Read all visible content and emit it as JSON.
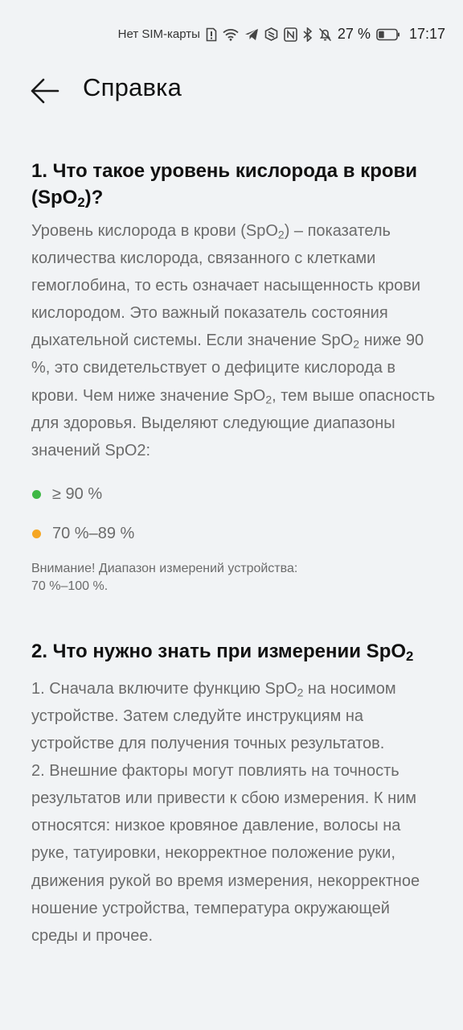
{
  "status_bar": {
    "carrier": "Нет SIM-карты",
    "battery_pct": "27 %",
    "time": "17:17"
  },
  "header": {
    "title": "Справка"
  },
  "section1": {
    "title_pre": "1. Что такое уровень кислорода в крови (SpO",
    "title_sub": "2",
    "title_post": ")?",
    "p1": "Уровень кислорода в крови (SpO",
    "p1_sub": "2",
    "p2": ") – показатель количества кислорода, связанного с клетками гемоглобина, то есть означает насыщенность крови кислородом. Это важный показатель состояния дыхательной системы. Если значение SpO",
    "p2_sub": "2",
    "p3": " ниже 90 %, это свидетельствует о дефиците кислорода в крови. Чем ниже значение SpO",
    "p3_sub": "2",
    "p4": ", тем выше опасность для здоровья. Выделяют следующие диапазоны значений SpO2:",
    "ranges": [
      {
        "label": "≥ 90 %",
        "color": "#3fb845"
      },
      {
        "label": "70 %–89 %",
        "color": "#f5a623"
      }
    ],
    "note_line1": "Внимание! Диапазон измерений устройства:",
    "note_line2": "70 %–100 %."
  },
  "section2": {
    "title_pre": "2. Что нужно знать при измерении SpO",
    "title_sub": "2",
    "item1_pre": "1. Сначала включите функцию SpO",
    "item1_sub": "2",
    "item1_post": " на носимом устройстве. Затем следуйте инструкциям на устройстве для получения точных результатов.",
    "item2": "2. Внешние факторы могут повлиять на точность результатов или привести к сбою измерения. К ним относятся: низкое кровяное давление, волосы на руке, татуировки, некорректное положение руки, движения рукой во время измерения, некорректное ношение устройства, температура окружающей среды и прочее."
  }
}
